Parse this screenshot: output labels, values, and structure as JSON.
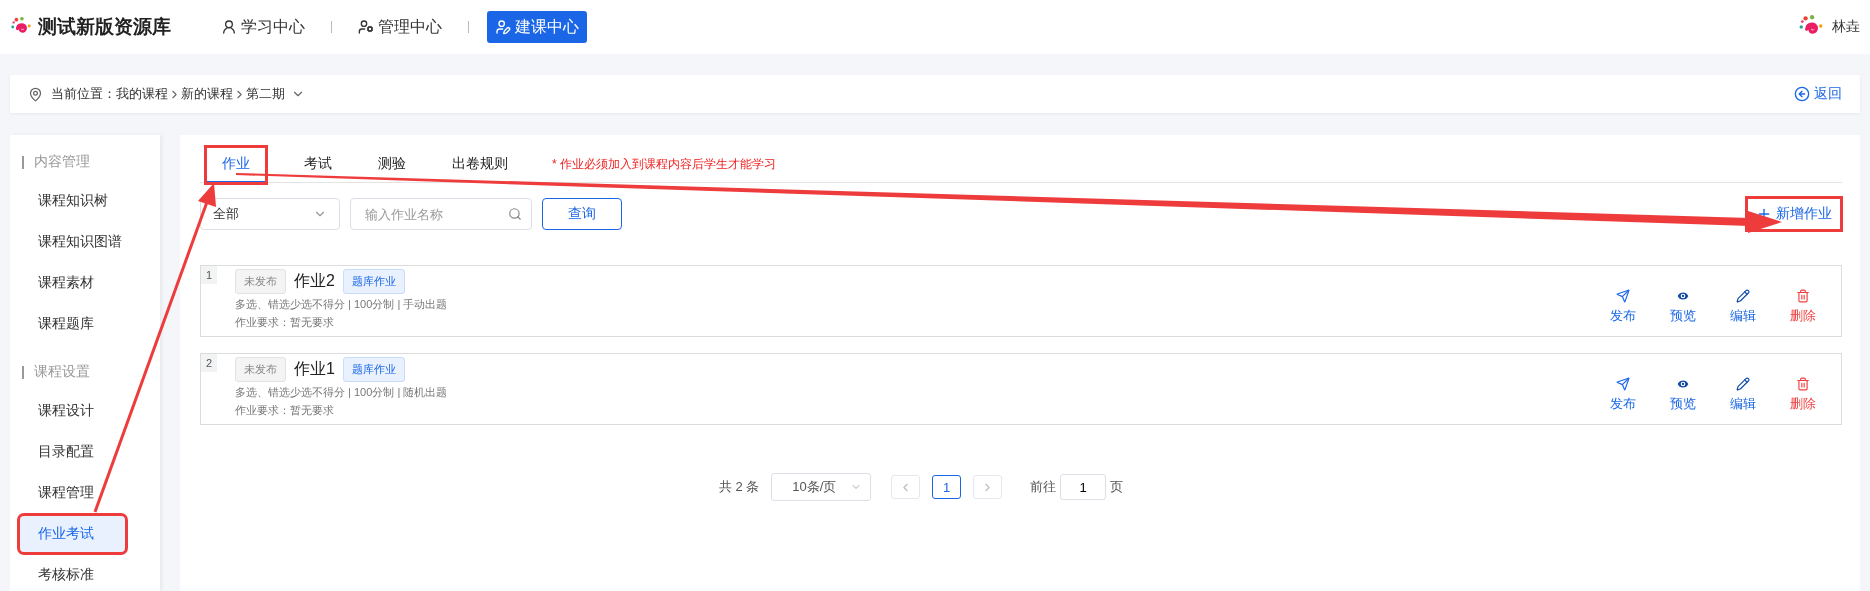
{
  "header": {
    "title": "测试新版资源库",
    "nav": [
      {
        "label": "学习中心",
        "kind": "study",
        "selected": false
      },
      {
        "label": "管理中心",
        "kind": "manage",
        "selected": false
      },
      {
        "label": "建课中心",
        "kind": "build",
        "selected": true
      }
    ],
    "user": "林垚"
  },
  "breadcrumb": {
    "label": "当前位置：",
    "path": [
      "我的课程",
      "新的课程",
      "第二期"
    ],
    "back": "返回"
  },
  "sidebar": {
    "groups": [
      {
        "title": "内容管理",
        "items": [
          {
            "label": "课程知识树",
            "selected": false,
            "highlighted": false
          },
          {
            "label": "课程知识图谱",
            "selected": false,
            "highlighted": false
          },
          {
            "label": "课程素材",
            "selected": false,
            "highlighted": false
          },
          {
            "label": "课程题库",
            "selected": false,
            "highlighted": false
          }
        ]
      },
      {
        "title": "课程设置",
        "items": [
          {
            "label": "课程设计",
            "selected": false,
            "highlighted": false
          },
          {
            "label": "目录配置",
            "selected": false,
            "highlighted": false
          },
          {
            "label": "课程管理",
            "selected": false,
            "highlighted": false
          },
          {
            "label": "作业考试",
            "selected": true,
            "highlighted": true
          },
          {
            "label": "考核标准",
            "selected": false,
            "highlighted": false
          }
        ]
      }
    ]
  },
  "tabs": [
    {
      "label": "作业",
      "selected": true,
      "highlighted": true
    },
    {
      "label": "考试",
      "selected": false,
      "highlighted": false
    },
    {
      "label": "测验",
      "selected": false,
      "highlighted": false
    },
    {
      "label": "出卷规则",
      "selected": false,
      "highlighted": false
    }
  ],
  "notice": "* 作业必须加入到课程内容后学生才能学习",
  "filter": {
    "status": "全部",
    "search": {
      "placeholder": "输入作业名称"
    },
    "query": "查询"
  },
  "add_button": {
    "label": "新增作业",
    "highlighted": true
  },
  "assignments": [
    {
      "index": "1",
      "status": "未发布",
      "title": "作业2",
      "tag": "题库作业",
      "meta": "多选、错选少选不得分 | 100分制 | 手动出题",
      "requirement": "作业要求：暂无要求",
      "actions": [
        {
          "kind": "publish",
          "label": "发布"
        },
        {
          "kind": "preview",
          "label": "预览"
        },
        {
          "kind": "edit",
          "label": "编辑"
        },
        {
          "kind": "delete",
          "label": "删除"
        }
      ]
    },
    {
      "index": "2",
      "status": "未发布",
      "title": "作业1",
      "tag": "题库作业",
      "meta": "多选、错选少选不得分 | 100分制 | 随机出题",
      "requirement": "作业要求：暂无要求",
      "actions": [
        {
          "kind": "publish",
          "label": "发布"
        },
        {
          "kind": "preview",
          "label": "预览"
        },
        {
          "kind": "edit",
          "label": "编辑"
        },
        {
          "kind": "delete",
          "label": "删除"
        }
      ]
    }
  ],
  "pagination": {
    "total": "共 2 条",
    "page_size": "10条/页",
    "pages": [
      {
        "label": "1",
        "selected": true
      }
    ],
    "goto_label": "前往",
    "goto_value": "1",
    "goto_suffix": "页"
  },
  "annotation": {
    "arrows": true
  }
}
